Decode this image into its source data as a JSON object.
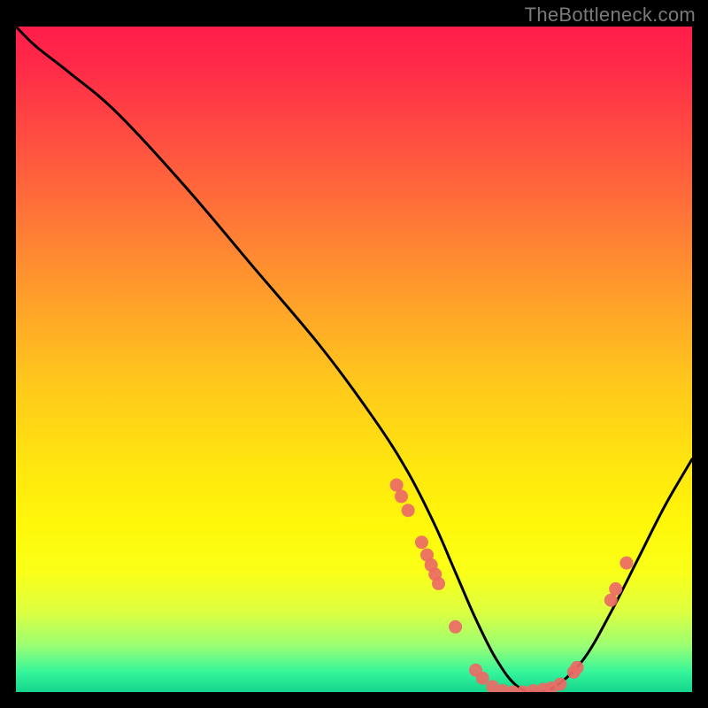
{
  "watermark": "TheBottleneck.com",
  "chart_data": {
    "type": "line",
    "title": "",
    "xlabel": "",
    "ylabel": "",
    "xlim": [
      0,
      100
    ],
    "ylim": [
      0,
      100
    ],
    "grid": false,
    "legend": false,
    "series": [
      {
        "name": "bottleneck-curve",
        "x": [
          0,
          3,
          8,
          15,
          25,
          35,
          45,
          53,
          58,
          62,
          65,
          68,
          71,
          74,
          77,
          80,
          84,
          88,
          92,
          96,
          100
        ],
        "y": [
          100,
          97,
          93,
          87,
          76,
          64,
          52,
          41,
          33,
          25,
          18,
          11,
          5,
          1,
          0,
          1,
          5,
          12,
          20,
          28,
          35
        ]
      }
    ],
    "scatter_points": [
      {
        "x": 56.3,
        "y": 31.1
      },
      {
        "x": 57.0,
        "y": 29.4
      },
      {
        "x": 58.0,
        "y": 27.3
      },
      {
        "x": 60.0,
        "y": 22.5
      },
      {
        "x": 60.8,
        "y": 20.6
      },
      {
        "x": 61.4,
        "y": 19.1
      },
      {
        "x": 62.0,
        "y": 17.7
      },
      {
        "x": 62.5,
        "y": 16.3
      },
      {
        "x": 65.0,
        "y": 9.8
      },
      {
        "x": 68.0,
        "y": 3.3
      },
      {
        "x": 69.0,
        "y": 2.1
      },
      {
        "x": 70.5,
        "y": 0.8
      },
      {
        "x": 72.0,
        "y": 0.2
      },
      {
        "x": 73.5,
        "y": 0.0
      },
      {
        "x": 75.0,
        "y": 0.0
      },
      {
        "x": 76.5,
        "y": 0.2
      },
      {
        "x": 78.0,
        "y": 0.4
      },
      {
        "x": 79.2,
        "y": 0.6
      },
      {
        "x": 80.5,
        "y": 1.2
      },
      {
        "x": 82.5,
        "y": 3.0
      },
      {
        "x": 83.0,
        "y": 3.7
      },
      {
        "x": 88.0,
        "y": 13.8
      },
      {
        "x": 88.7,
        "y": 15.5
      },
      {
        "x": 90.3,
        "y": 19.4
      }
    ],
    "gradient_stops": [
      {
        "pos": 0,
        "color": "#ff1d4a"
      },
      {
        "pos": 50,
        "color": "#ffc91b"
      },
      {
        "pos": 82,
        "color": "#faff18"
      },
      {
        "pos": 100,
        "color": "#14d58c"
      }
    ]
  }
}
